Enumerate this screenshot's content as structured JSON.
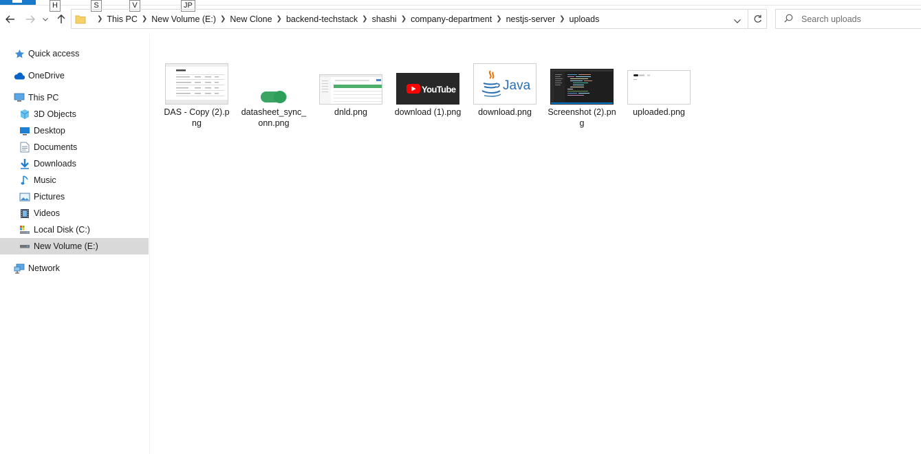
{
  "ribbon": {
    "keytips": [
      "H",
      "S",
      "V",
      "JP"
    ]
  },
  "nav": {
    "back_icon": "arrow-left-icon",
    "forward_icon": "arrow-right-icon",
    "recent_icon": "chevron-down-icon",
    "up_icon": "arrow-up-icon"
  },
  "address": {
    "crumbs": [
      "This PC",
      "New Volume (E:)",
      "New Clone",
      "backend-techstack",
      "shashi",
      "company-department",
      "nestjs-server",
      "uploads"
    ]
  },
  "search": {
    "placeholder": "Search uploads"
  },
  "sidebar": {
    "items": [
      {
        "label": "Quick access",
        "icon": "star-icon"
      },
      {
        "label": "OneDrive",
        "icon": "cloud-icon"
      },
      {
        "label": "This PC",
        "icon": "computer-icon"
      },
      {
        "label": "3D Objects",
        "icon": "cube-icon"
      },
      {
        "label": "Desktop",
        "icon": "desktop-icon"
      },
      {
        "label": "Documents",
        "icon": "document-icon"
      },
      {
        "label": "Downloads",
        "icon": "download-icon"
      },
      {
        "label": "Music",
        "icon": "music-icon"
      },
      {
        "label": "Pictures",
        "icon": "pictures-icon"
      },
      {
        "label": "Videos",
        "icon": "video-icon"
      },
      {
        "label": "Local Disk (C:)",
        "icon": "drive-icon"
      },
      {
        "label": "New Volume (E:)",
        "icon": "drive-icon"
      },
      {
        "label": "Network",
        "icon": "network-icon"
      }
    ],
    "selected": "New Volume (E:)"
  },
  "files": [
    {
      "name": "DAS - Copy (2).png"
    },
    {
      "name": "datasheet_sync_onn.png"
    },
    {
      "name": "dnld.png"
    },
    {
      "name": "download (1).png",
      "thumb_text": "YouTube"
    },
    {
      "name": "download.png",
      "thumb_text": "Java"
    },
    {
      "name": "Screenshot (2).png"
    },
    {
      "name": "uploaded.png"
    }
  ],
  "colors": {
    "accent": "#1979ca",
    "selection": "#d9d9d9",
    "youtube_red": "#ff0000",
    "java_blue": "#2a6fb3",
    "java_orange": "#e76f00",
    "toggle_green": "#2e9e5b"
  }
}
